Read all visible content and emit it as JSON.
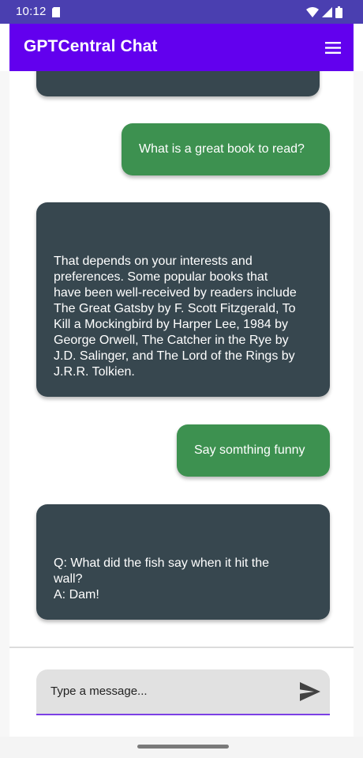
{
  "status_bar": {
    "time": "10:12",
    "icons": [
      "sim-card-icon",
      "wifi-icon",
      "signal-icon",
      "battery-icon"
    ]
  },
  "app_bar": {
    "title": "GPTCentral Chat",
    "menu_icon": "menu-icon"
  },
  "messages": [
    {
      "role": "bot",
      "text": ""
    },
    {
      "role": "user",
      "text": "What is a great book to read?"
    },
    {
      "role": "bot",
      "text": "That depends on your interests and\npreferences. Some popular books that\nhave been well-received by readers include\nThe Great Gatsby by F. Scott Fitzgerald, To\nKill a Mockingbird by Harper Lee, 1984 by\nGeorge Orwell, The Catcher in the Rye by\nJ.D. Salinger, and The Lord of the Rings by\nJ.R.R. Tolkien."
    },
    {
      "role": "user",
      "text": "Say somthing funny"
    },
    {
      "role": "bot",
      "text": "Q: What did the fish say when it hit the\nwall?\nA: Dam!"
    }
  ],
  "composer": {
    "placeholder": "Type a message...",
    "send_icon": "send-icon"
  },
  "colors": {
    "status_bar": "#4A3FB0",
    "app_bar": "#6200EE",
    "bot_bubble": "#37474F",
    "user_bubble": "#3D9150",
    "input_underline": "#7B3FE4"
  }
}
